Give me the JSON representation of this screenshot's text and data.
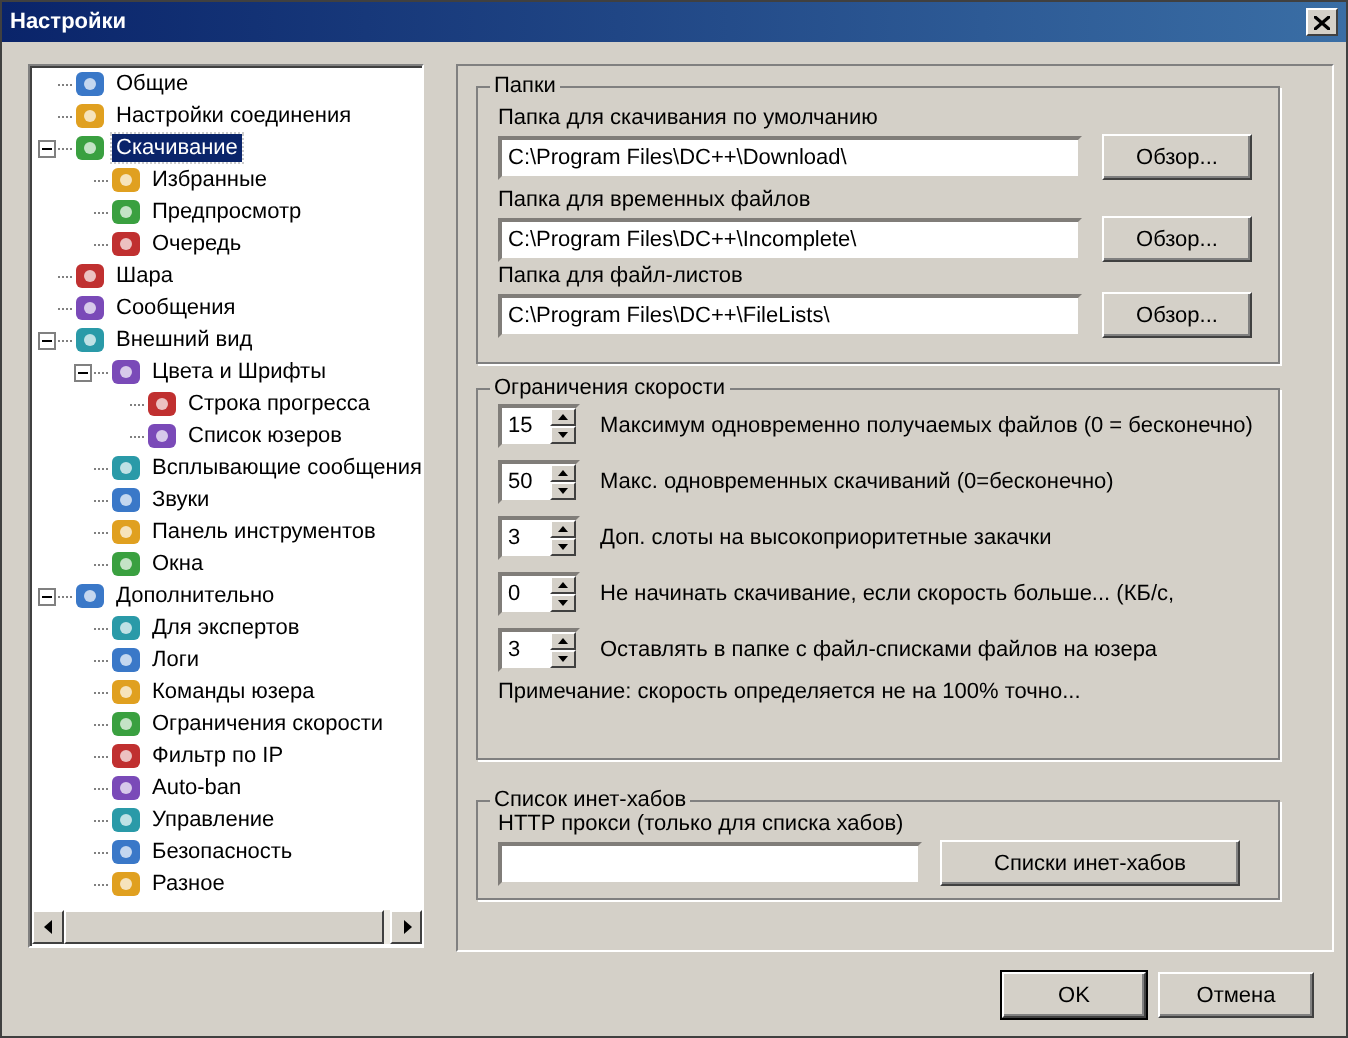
{
  "window": {
    "title": "Настройки"
  },
  "tree": [
    {
      "label": "Общие",
      "selected": false
    },
    {
      "label": "Настройки соединения",
      "selected": false
    },
    {
      "label": "Скачивание",
      "selected": true,
      "expanded": true,
      "children": [
        {
          "label": "Избранные",
          "selected": false
        },
        {
          "label": "Предпросмотр",
          "selected": false
        },
        {
          "label": "Очередь",
          "selected": false
        }
      ]
    },
    {
      "label": "Шара",
      "selected": false
    },
    {
      "label": "Сообщения",
      "selected": false
    },
    {
      "label": "Внешний вид",
      "selected": false,
      "expanded": true,
      "children": [
        {
          "label": "Цвета и Шрифты",
          "selected": false,
          "expanded": true,
          "children": [
            {
              "label": "Строка прогресса",
              "selected": false
            },
            {
              "label": "Список юзеров",
              "selected": false
            }
          ]
        },
        {
          "label": "Всплывающие сообщения",
          "selected": false
        },
        {
          "label": "Звуки",
          "selected": false
        },
        {
          "label": "Панель инструментов",
          "selected": false
        },
        {
          "label": "Окна",
          "selected": false
        }
      ]
    },
    {
      "label": "Дополнительно",
      "selected": false,
      "expanded": true,
      "children": [
        {
          "label": "Для экспертов",
          "selected": false
        },
        {
          "label": "Логи",
          "selected": false
        },
        {
          "label": "Команды юзера",
          "selected": false
        },
        {
          "label": "Ограничения скорости",
          "selected": false
        },
        {
          "label": "Фильтр по IP",
          "selected": false
        },
        {
          "label": "Auto-ban",
          "selected": false
        },
        {
          "label": "Управление",
          "selected": false
        },
        {
          "label": "Безопасность",
          "selected": false
        },
        {
          "label": "Разное",
          "selected": false
        }
      ]
    }
  ],
  "folders": {
    "title": "Папки",
    "fields": [
      {
        "label": "Папка для скачивания по умолчанию",
        "value": "C:\\Program Files\\DC++\\Download\\",
        "button": "Обзор..."
      },
      {
        "label": "Папка для временных файлов",
        "value": "C:\\Program Files\\DC++\\Incomplete\\",
        "button": "Обзор..."
      },
      {
        "label": "Папка для файл-листов",
        "value": "C:\\Program Files\\DC++\\FileLists\\",
        "button": "Обзор..."
      }
    ]
  },
  "speed_limits": {
    "title": "Ограничения скорости",
    "rows": [
      {
        "value": "15",
        "label": "Максимум одновременно получаемых файлов (0 = бесконечно)"
      },
      {
        "value": "50",
        "label": "Макс. одновременных скачиваний (0=бесконечно)"
      },
      {
        "value": "3",
        "label": "Доп. слоты на высокоприоритетные закачки"
      },
      {
        "value": "0",
        "label": "Не начинать скачивание, если скорость больше... (КБ/с,"
      },
      {
        "value": "3",
        "label": "Оставлять в папке с файл-списками файлов на юзера"
      }
    ],
    "note": "Примечание: скорость определяется не на 100% точно..."
  },
  "hublist": {
    "title": "Список инет-хабов",
    "proxy_label": "HTTP прокси (только для списка хабов)",
    "button": "Списки инет-хабов"
  },
  "buttons": [
    "OK",
    "Отмена"
  ]
}
